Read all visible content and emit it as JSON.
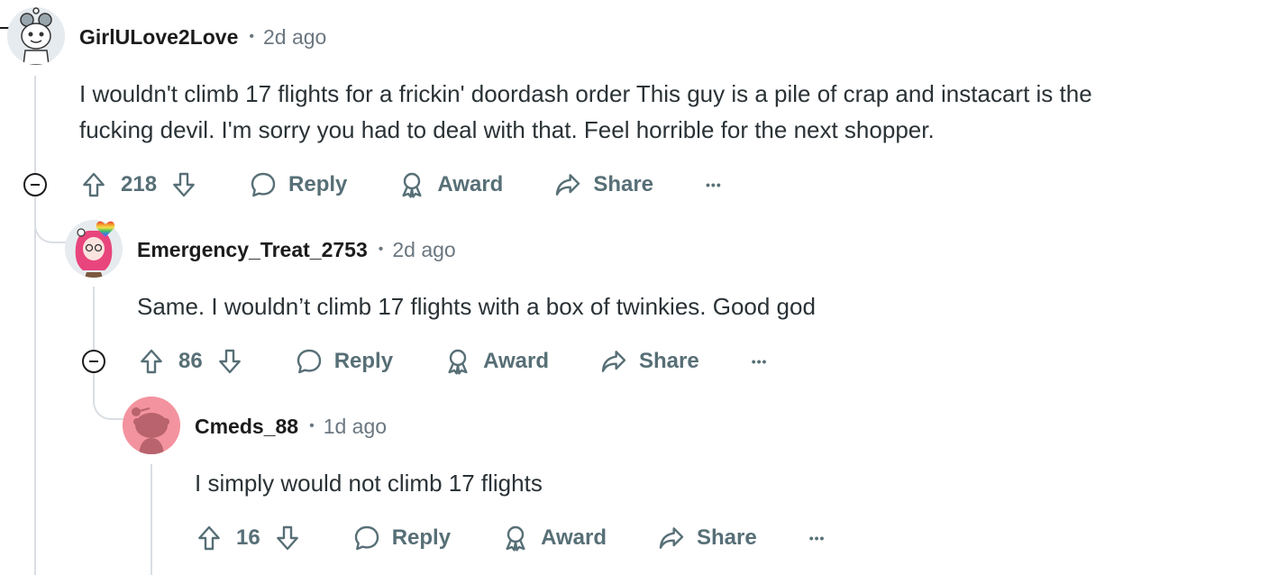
{
  "comments": [
    {
      "username": "GirlULove2Love",
      "time": "2d ago",
      "body_lines": [
        "I wouldn't climb 17 flights for a frickin' doordash order This guy is a pile of crap and instacart is the",
        "fucking devil. I'm sorry you had to deal with that. Feel horrible for the next shopper."
      ],
      "votes": "218",
      "reply_label": "Reply",
      "award_label": "Award",
      "share_label": "Share",
      "more_label": "•••"
    },
    {
      "username": "Emergency_Treat_2753",
      "time": "2d ago",
      "body_lines": [
        "Same. I wouldn’t climb 17 flights with a box of twinkies. Good god"
      ],
      "votes": "86",
      "reply_label": "Reply",
      "award_label": "Award",
      "share_label": "Share",
      "more_label": "•••"
    },
    {
      "username": "Cmeds_88",
      "time": "1d ago",
      "body_lines": [
        "I simply would not climb 17 flights"
      ],
      "votes": "16",
      "reply_label": "Reply",
      "award_label": "Award",
      "share_label": "Share",
      "more_label": "•••"
    }
  ],
  "separator": "•",
  "colors": {
    "thread_line": "#d9dee3",
    "meta_text": "#6b7780",
    "action_text": "#576f76",
    "avatar3_bg": "#f3939f"
  }
}
